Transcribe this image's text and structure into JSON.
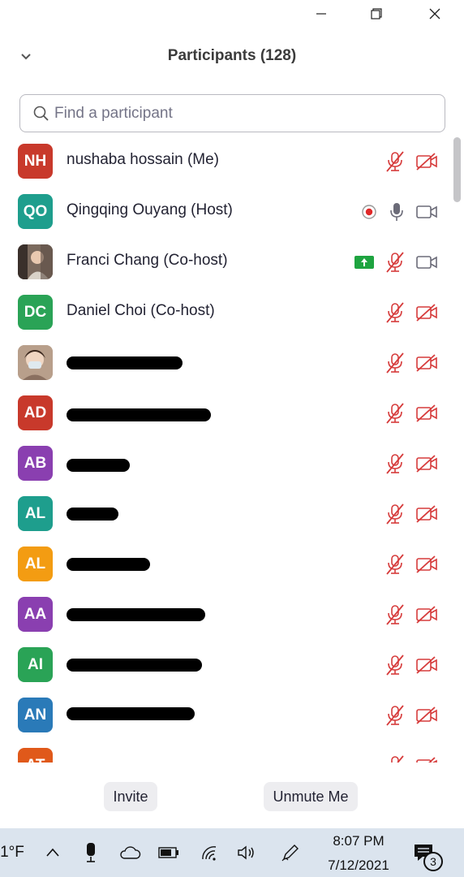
{
  "window": {
    "minimize_icon": "minimize-icon",
    "restore_icon": "restore-icon",
    "close_icon": "close-icon"
  },
  "header": {
    "title": "Participants (128)"
  },
  "search": {
    "placeholder": "Find a participant"
  },
  "colors": {
    "muted_red": "#d63b3b",
    "share_green": "#1ea440"
  },
  "participants": [
    {
      "initials": "NH",
      "name": "nushaba hossain (Me)",
      "color": "#c8392b",
      "mic": "muted",
      "video": "off"
    },
    {
      "initials": "QO",
      "name": "Qingqing Ouyang (Host)",
      "color": "#1e9e8d",
      "mic": "on",
      "video": "on",
      "recording": true
    },
    {
      "initials": "",
      "name": "Franci Chang (Co-host)",
      "photo": true,
      "mic": "muted",
      "video": "on",
      "sharing": true
    },
    {
      "initials": "DC",
      "name": "Daniel Choi (Co-host)",
      "color": "#2aa356",
      "mic": "muted",
      "video": "off"
    },
    {
      "initials": "",
      "name": "",
      "photo": true,
      "mic": "muted",
      "video": "off",
      "redacted": true
    },
    {
      "initials": "AD",
      "name": "",
      "color": "#c8392b",
      "mic": "muted",
      "video": "off",
      "redacted": true
    },
    {
      "initials": "AB",
      "name": "",
      "color": "#8a3fb0",
      "mic": "muted",
      "video": "off",
      "redacted": true
    },
    {
      "initials": "AL",
      "name": "",
      "color": "#1e9e8d",
      "mic": "muted",
      "video": "off",
      "redacted": true
    },
    {
      "initials": "AL",
      "name": "",
      "color": "#f39c12",
      "mic": "muted",
      "video": "off",
      "redacted": true
    },
    {
      "initials": "AA",
      "name": "",
      "color": "#8a3fb0",
      "mic": "muted",
      "video": "off",
      "redacted": true
    },
    {
      "initials": "AI",
      "name": "",
      "color": "#2aa356",
      "mic": "muted",
      "video": "off",
      "redacted": true
    },
    {
      "initials": "AN",
      "name": "",
      "color": "#2a7ab8",
      "mic": "muted",
      "video": "off",
      "redacted": true
    },
    {
      "initials": "AT",
      "name": "",
      "color": "#e0591a",
      "mic": "muted",
      "video": "off",
      "redacted": false,
      "partial": true
    }
  ],
  "footer": {
    "invite": "Invite",
    "unmute": "Unmute Me"
  },
  "taskbar": {
    "temperature": "1°F",
    "time": "8:07 PM",
    "date": "7/12/2021",
    "notification_count": "3"
  }
}
